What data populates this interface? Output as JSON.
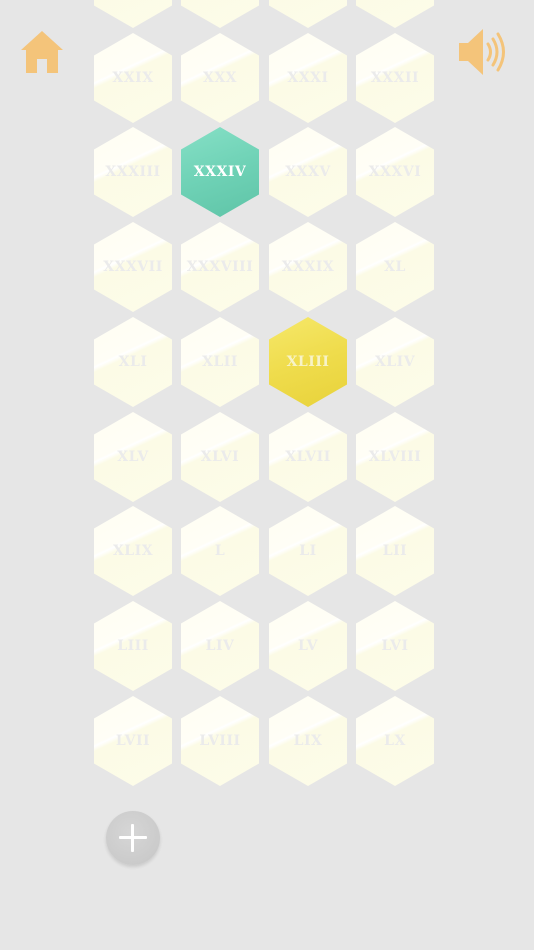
{
  "header": {
    "home_icon": "home-icon",
    "sound_icon": "speaker-on-icon"
  },
  "colors": {
    "accent_orange": "#f4c47a",
    "tile_default": "#fdfce9",
    "tile_selected_green": "#6fd2b6",
    "tile_selected_yellow": "#efdc4c"
  },
  "levels": [
    {
      "label": "",
      "state": "default"
    },
    {
      "label": "",
      "state": "default"
    },
    {
      "label": "",
      "state": "default"
    },
    {
      "label": "",
      "state": "default"
    },
    {
      "label": "XXIX",
      "state": "default"
    },
    {
      "label": "XXX",
      "state": "default"
    },
    {
      "label": "XXXI",
      "state": "default"
    },
    {
      "label": "XXXII",
      "state": "default"
    },
    {
      "label": "XXXIII",
      "state": "default"
    },
    {
      "label": "XXXIV",
      "state": "green"
    },
    {
      "label": "XXXV",
      "state": "default"
    },
    {
      "label": "XXXVI",
      "state": "default"
    },
    {
      "label": "XXXVII",
      "state": "default"
    },
    {
      "label": "XXXVIII",
      "state": "default"
    },
    {
      "label": "XXXIX",
      "state": "default"
    },
    {
      "label": "XL",
      "state": "default"
    },
    {
      "label": "XLI",
      "state": "default"
    },
    {
      "label": "XLII",
      "state": "default"
    },
    {
      "label": "XLIII",
      "state": "yellow"
    },
    {
      "label": "XLIV",
      "state": "default"
    },
    {
      "label": "XLV",
      "state": "default"
    },
    {
      "label": "XLVI",
      "state": "default"
    },
    {
      "label": "XLVII",
      "state": "default"
    },
    {
      "label": "XLVIII",
      "state": "default"
    },
    {
      "label": "XLIX",
      "state": "default"
    },
    {
      "label": "L",
      "state": "default"
    },
    {
      "label": "LI",
      "state": "default"
    },
    {
      "label": "LII",
      "state": "default"
    },
    {
      "label": "LIII",
      "state": "default"
    },
    {
      "label": "LIV",
      "state": "default"
    },
    {
      "label": "LV",
      "state": "default"
    },
    {
      "label": "LVI",
      "state": "default"
    },
    {
      "label": "LVII",
      "state": "default"
    },
    {
      "label": "LVIII",
      "state": "default"
    },
    {
      "label": "LIX",
      "state": "default"
    },
    {
      "label": "LX",
      "state": "default"
    }
  ],
  "add_button": {
    "icon": "plus-icon"
  }
}
